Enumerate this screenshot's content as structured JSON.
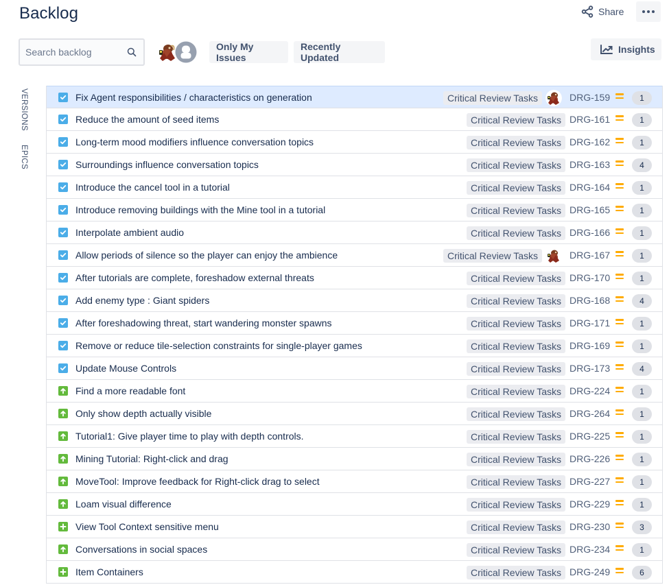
{
  "header": {
    "title": "Backlog",
    "share_label": "Share",
    "more_icon": "more-horizontal-icon",
    "share_icon": "share-icon"
  },
  "toolbar": {
    "search_placeholder": "Search backlog",
    "search_value": "",
    "search_icon": "search-icon",
    "avatars": [
      {
        "name": "mascot-avatar",
        "kind": "custom-image"
      },
      {
        "name": "default-avatar",
        "kind": "placeholder"
      }
    ],
    "quick_filters": [
      "Only My Issues",
      "Recently Updated"
    ],
    "insights_label": "Insights",
    "insights_icon": "chart-line-icon"
  },
  "side_tabs": [
    "VERSIONS",
    "EPICS"
  ],
  "colors": {
    "task": "#4bade8",
    "story": "#63ba3c",
    "priority_medium": "#ffab00",
    "selected_row": "#deebff"
  },
  "issues": [
    {
      "type": "task",
      "summary": "Fix Agent responsibilities / characteristics on generation",
      "epic": "Critical Review Tasks",
      "assignee": true,
      "key": "DRG-159",
      "priority": "medium",
      "estimate": "1",
      "selected": true
    },
    {
      "type": "task",
      "summary": "Reduce the amount of seed items",
      "epic": "Critical Review Tasks",
      "assignee": false,
      "key": "DRG-161",
      "priority": "medium",
      "estimate": "1"
    },
    {
      "type": "task",
      "summary": "Long-term mood modifiers influence conversation topics",
      "epic": "Critical Review Tasks",
      "assignee": false,
      "key": "DRG-162",
      "priority": "medium",
      "estimate": "1"
    },
    {
      "type": "task",
      "summary": "Surroundings influence conversation topics",
      "epic": "Critical Review Tasks",
      "assignee": false,
      "key": "DRG-163",
      "priority": "medium",
      "estimate": "4"
    },
    {
      "type": "task",
      "summary": "Introduce the cancel tool in a tutorial",
      "epic": "Critical Review Tasks",
      "assignee": false,
      "key": "DRG-164",
      "priority": "medium",
      "estimate": "1"
    },
    {
      "type": "task",
      "summary": "Introduce removing buildings with the Mine tool in a tutorial",
      "epic": "Critical Review Tasks",
      "assignee": false,
      "key": "DRG-165",
      "priority": "medium",
      "estimate": "1"
    },
    {
      "type": "task",
      "summary": "Interpolate ambient audio",
      "epic": "Critical Review Tasks",
      "assignee": false,
      "key": "DRG-166",
      "priority": "medium",
      "estimate": "1"
    },
    {
      "type": "task",
      "summary": "Allow periods of silence so the player can enjoy the ambience",
      "epic": "Critical Review Tasks",
      "assignee": true,
      "key": "DRG-167",
      "priority": "medium",
      "estimate": "1"
    },
    {
      "type": "task",
      "summary": "After tutorials are complete, foreshadow external threats",
      "epic": "Critical Review Tasks",
      "assignee": false,
      "key": "DRG-170",
      "priority": "medium",
      "estimate": "1"
    },
    {
      "type": "task",
      "summary": "Add enemy type : Giant spiders",
      "epic": "Critical Review Tasks",
      "assignee": false,
      "key": "DRG-168",
      "priority": "medium",
      "estimate": "4"
    },
    {
      "type": "task",
      "summary": "After foreshadowing threat, start wandering monster spawns",
      "epic": "Critical Review Tasks",
      "assignee": false,
      "key": "DRG-171",
      "priority": "medium",
      "estimate": "1"
    },
    {
      "type": "task",
      "summary": "Remove or reduce tile-selection constraints for single-player games",
      "epic": "Critical Review Tasks",
      "assignee": false,
      "key": "DRG-169",
      "priority": "medium",
      "estimate": "1"
    },
    {
      "type": "task",
      "summary": "Update Mouse Controls",
      "epic": "Critical Review Tasks",
      "assignee": false,
      "key": "DRG-173",
      "priority": "medium",
      "estimate": "4"
    },
    {
      "type": "story",
      "summary": "Find a more readable font",
      "epic": "Critical Review Tasks",
      "assignee": false,
      "key": "DRG-224",
      "priority": "medium",
      "estimate": "1"
    },
    {
      "type": "story",
      "summary": "Only show depth actually visible",
      "epic": "Critical Review Tasks",
      "assignee": false,
      "key": "DRG-264",
      "priority": "medium",
      "estimate": "1"
    },
    {
      "type": "story",
      "summary": "Tutorial1: Give player time to play with depth controls.",
      "epic": "Critical Review Tasks",
      "assignee": false,
      "key": "DRG-225",
      "priority": "medium",
      "estimate": "1"
    },
    {
      "type": "story",
      "summary": "Mining Tutorial: Right-click and drag",
      "epic": "Critical Review Tasks",
      "assignee": false,
      "key": "DRG-226",
      "priority": "medium",
      "estimate": "1"
    },
    {
      "type": "story",
      "summary": "MoveTool: Improve feedback for Right-click drag to select",
      "epic": "Critical Review Tasks",
      "assignee": false,
      "key": "DRG-227",
      "priority": "medium",
      "estimate": "1"
    },
    {
      "type": "story",
      "summary": "Loam visual difference",
      "epic": "Critical Review Tasks",
      "assignee": false,
      "key": "DRG-229",
      "priority": "medium",
      "estimate": "1"
    },
    {
      "type": "new-feature",
      "summary": "View Tool Context sensitive menu",
      "epic": "Critical Review Tasks",
      "assignee": false,
      "key": "DRG-230",
      "priority": "medium",
      "estimate": "3"
    },
    {
      "type": "story",
      "summary": "Conversations in social spaces",
      "epic": "Critical Review Tasks",
      "assignee": false,
      "key": "DRG-234",
      "priority": "medium",
      "estimate": "1"
    },
    {
      "type": "new-feature",
      "summary": "Item Containers",
      "epic": "Critical Review Tasks",
      "assignee": false,
      "key": "DRG-249",
      "priority": "medium",
      "estimate": "6"
    }
  ]
}
